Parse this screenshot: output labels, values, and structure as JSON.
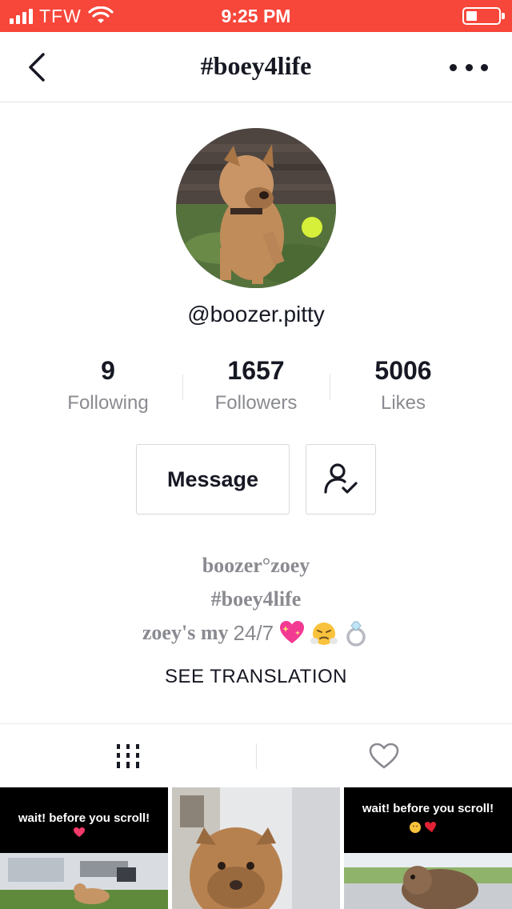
{
  "status_bar": {
    "carrier": "TFW",
    "time": "9:25 PM"
  },
  "nav": {
    "title": "#boey4life"
  },
  "profile": {
    "username": "@boozer.pitty",
    "stats": [
      {
        "value": "9",
        "label": "Following"
      },
      {
        "value": "1657",
        "label": "Followers"
      },
      {
        "value": "5006",
        "label": "Likes"
      }
    ],
    "message_label": "Message"
  },
  "bio": {
    "line1": "boozer°zoey",
    "line2": "#boey4life",
    "line3_prefix": "zoey's my",
    "line3_number": "24/7",
    "see_translation": "SEE TRANSLATION"
  },
  "videos": [
    {
      "caption": "wait! before you scroll!"
    },
    {
      "caption": ""
    },
    {
      "caption": "wait! before you scroll!"
    }
  ],
  "colors": {
    "status_bar": "#f7463a",
    "text_primary": "#161823",
    "text_secondary": "#8a8b91"
  }
}
